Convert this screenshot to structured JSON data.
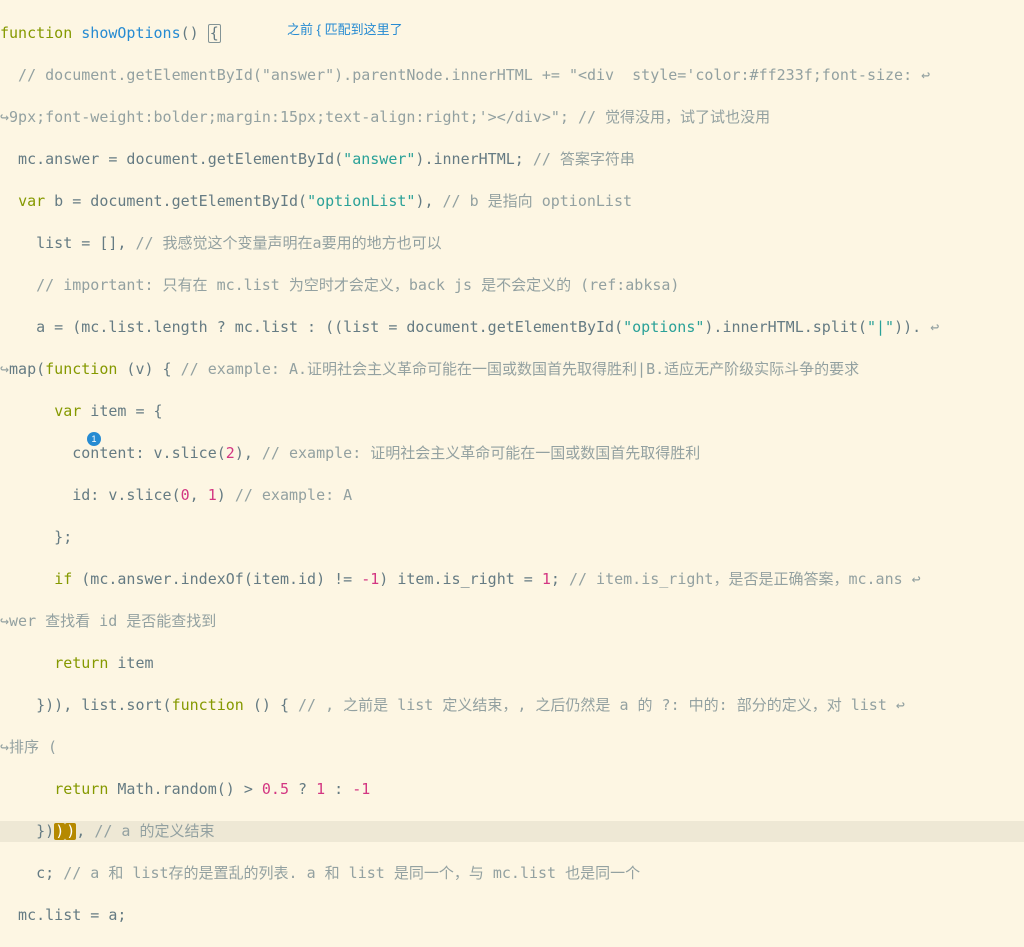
{
  "editor": {
    "hint_text": "之前 { 匹配到这里了",
    "badge_value": "1",
    "lines": [
      {
        "i": 0,
        "kind": "plain"
      },
      {
        "i": 1,
        "kind": "plain"
      },
      {
        "i": 2,
        "kind": "wrap"
      },
      {
        "i": 3,
        "kind": "plain"
      },
      {
        "i": 4,
        "kind": "plain"
      },
      {
        "i": 5,
        "kind": "plain"
      },
      {
        "i": 6,
        "kind": "plain"
      },
      {
        "i": 7,
        "kind": "plain"
      },
      {
        "i": 8,
        "kind": "wrap"
      },
      {
        "i": 9,
        "kind": "plain"
      },
      {
        "i": 10,
        "kind": "plain"
      },
      {
        "i": 11,
        "kind": "plain"
      },
      {
        "i": 12,
        "kind": "plain"
      },
      {
        "i": 13,
        "kind": "plain"
      },
      {
        "i": 14,
        "kind": "wrap"
      },
      {
        "i": 15,
        "kind": "plain"
      },
      {
        "i": 16,
        "kind": "plain"
      },
      {
        "i": 17,
        "kind": "wrap"
      },
      {
        "i": 18,
        "kind": "plain"
      },
      {
        "i": 19,
        "kind": "cursor"
      },
      {
        "i": 20,
        "kind": "plain"
      },
      {
        "i": 21,
        "kind": "plain"
      }
    ],
    "l0_fn": "function",
    "l0_name": "showOptions",
    "l0_paren": "()",
    "l0_sp": " ",
    "l0_brace": "{",
    "l1": "  // document.getElementById(\"answer\").parentNode.innerHTML += \"<div  style='color:#ff233f;font-size: ",
    "l2_pre": "",
    "l2": "9px;font-weight:bolder;margin:15px;text-align:right;'></div>\"; // 觉得没用，试了试也没用",
    "l3_a": "  mc.answer = document.getElementById(",
    "l3_s": "\"answer\"",
    "l3_b": ").innerHTML; ",
    "l3_c": "// 答案字符串",
    "l4_a": "  ",
    "l4_kw": "var",
    "l4_b": " b = document.getElementById(",
    "l4_s": "\"optionList\"",
    "l4_c": "), ",
    "l4_d": "// b 是指向 optionList",
    "l5_a": "    list = [], ",
    "l5_b": "// 我感觉这个变量声明在a要用的地方也可以",
    "l6": "    // important: 只有在 mc.list 为空时才会定义，back js 是不会定义的 (ref:abksa)",
    "l7_a": "    a = (mc.list.length ? mc.list : ((list = document.getElementById(",
    "l7_s": "\"options\"",
    "l7_b": ").innerHTML.split(",
    "l7_s2": "\"|\"",
    "l7_c": ")). ",
    "l8_pre": "",
    "l8_a": "map(",
    "l8_kw": "function",
    "l8_b": " (v) { ",
    "l8_c": "// example: A.证明社会主义革命可能在一国或数国首先取得胜利|B.适应无产阶级实际斗争的要求",
    "l9_a": "      ",
    "l9_kw": "var",
    "l9_b": " item = {",
    "l10_a": "        content: v.slice(",
    "l10_n": "2",
    "l10_b": "), ",
    "l10_c": "// example: 证明社会主义革命可能在一国或数国首先取得胜利",
    "l11_a": "        id: v.slice(",
    "l11_n1": "0",
    "l11_m": ", ",
    "l11_n2": "1",
    "l11_b": ") ",
    "l11_c": "// example: A",
    "l12": "      };",
    "l13_a": "      ",
    "l13_kw": "if",
    "l13_b": " (mc.answer.indexOf(item.id) != ",
    "l13_n": "-1",
    "l13_c": ") item.is_right = ",
    "l13_n2": "1",
    "l13_d": "; ",
    "l13_e": "// item.is_right，是否是正确答案，mc.ans ",
    "l14_pre": "",
    "l14": "wer 查找看 id 是否能查找到",
    "l15_a": "      ",
    "l15_kw": "return",
    "l15_b": " item",
    "l16_a": "    })), list.sort(",
    "l16_kw": "function",
    "l16_b": " () { ",
    "l16_c": "// , 之前是 list 定义结束，, 之后仍然是 a 的 ?: 中的: 部分的定义，对 list ",
    "l17_pre": "",
    "l17": "排序 (",
    "l18_a": "      ",
    "l18_kw": "return",
    "l18_b": " Math.random() > ",
    "l18_n1": "0.5",
    "l18_c": " ? ",
    "l18_n2": "1",
    "l18_d": " : ",
    "l18_n3": "-1",
    "l19_a": "    })",
    "l19_br1": ")",
    "l19_br2": ")",
    "l19_b": ", ",
    "l19_c": "// a 的定义结束",
    "l20_a": "    c; ",
    "l20_b": "// a 和 list存的是置乱的列表. a 和 list 是同一个，与 mc.list 也是同一个",
    "l21": "  mc.list = a;"
  }
}
